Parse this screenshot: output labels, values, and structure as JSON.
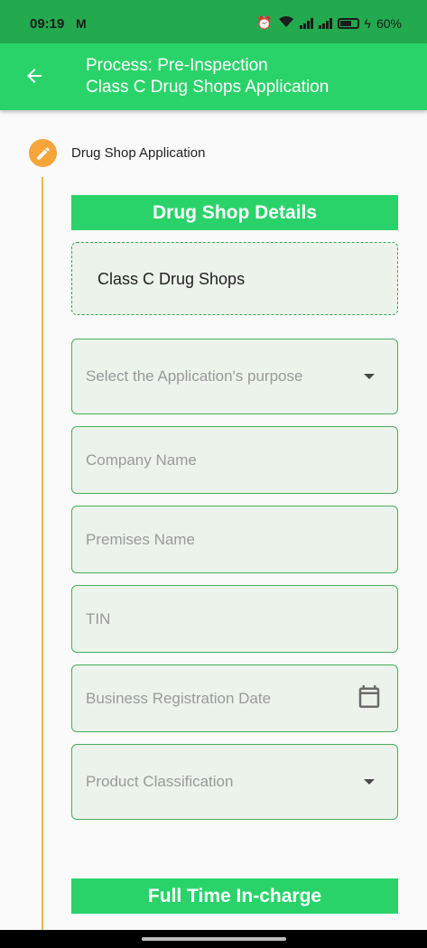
{
  "status_bar": {
    "time": "09:19",
    "mail_icon": "gmail-icon",
    "battery": "60%"
  },
  "app_bar": {
    "back_icon": "arrow-left-icon",
    "title_line1": "Process: Pre-Inspection",
    "title_line2": "Class C Drug Shops Application"
  },
  "step": {
    "icon": "pencil-icon",
    "title": "Drug Shop Application"
  },
  "section1": {
    "header": "Drug Shop Details",
    "application_type": "Class C Drug Shops",
    "fields": {
      "purpose": "Select the Application's purpose",
      "company_name": "Company Name",
      "premises_name": "Premises Name",
      "tin": "TIN",
      "business_reg_date": "Business Registration Date",
      "product_classification": "Product Classification"
    }
  },
  "section2": {
    "header": "Full Time  In-charge"
  },
  "colors": {
    "status_bar": "#23a94e",
    "app_bar": "#2ad36a",
    "step_circle": "#f6a53a",
    "field_bg": "#ebf3ea",
    "field_border": "#48ad5f"
  }
}
